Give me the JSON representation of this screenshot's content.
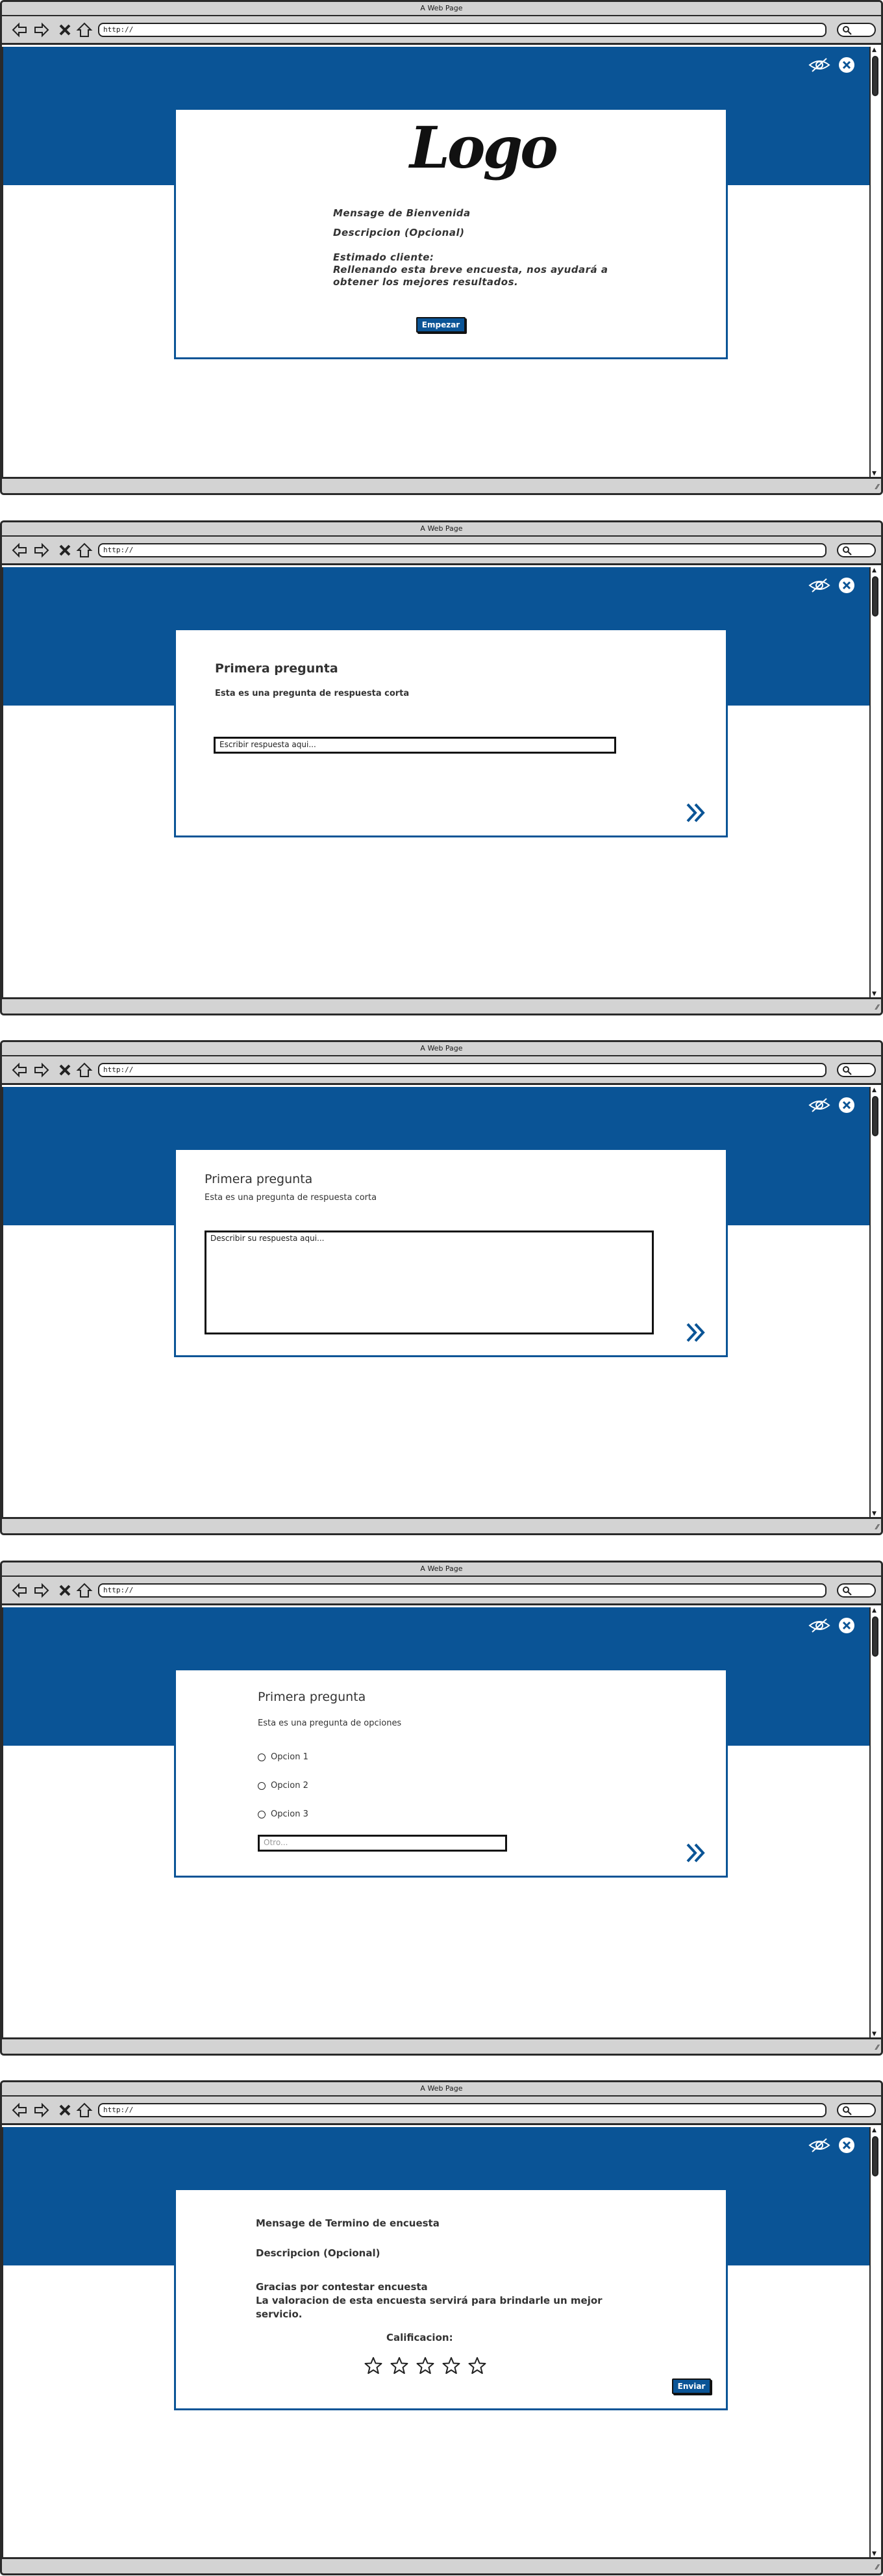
{
  "browser": {
    "window_title": "A Web Page",
    "url": "http://"
  },
  "colors": {
    "brand_blue": "#0a5496",
    "chrome_gray": "#d3d3d3"
  },
  "icons": [
    "back-arrow-icon",
    "forward-arrow-icon",
    "close-x-icon",
    "home-icon",
    "search-icon",
    "eye-slash-icon",
    "close-circle-icon",
    "double-chevron-right-icon",
    "star-icon",
    "resize-grip-icon"
  ],
  "screens": {
    "welcome": {
      "logo_text": "Logo",
      "welcome_message": "Mensage de Bienvenida",
      "description": "Descripcion (Opcional)",
      "greeting_line1": "Estimado cliente:",
      "greeting_line2": "Rellenando esta breve encuesta, nos ayudará a",
      "greeting_line3": "obtener los mejores resultados.",
      "start_button": "Empezar"
    },
    "short_answer": {
      "question_title": "Primera pregunta",
      "question_subtitle": "Esta es una pregunta de respuesta corta",
      "input_placeholder": "Escribir respuesta aqui..."
    },
    "long_answer": {
      "question_title": "Primera pregunta",
      "question_subtitle": "Esta es una pregunta de respuesta corta",
      "textarea_placeholder": "Describir su respuesta aqui..."
    },
    "options": {
      "question_title": "Primera pregunta",
      "question_subtitle": "Esta es una pregunta de opciones",
      "option1": "Opcion 1",
      "option2": "Opcion 2",
      "option3": "Opcion 3",
      "other_placeholder": "Otro..."
    },
    "finish": {
      "finish_message": "Mensage de Termino de encuesta",
      "description": "Descripcion (Opcional)",
      "thanks_line1": "Gracias por contestar encuesta",
      "thanks_line2": "La valoracion de esta encuesta servirá para brindarle un mejor",
      "thanks_line3": "servicio.",
      "rating_label": "Calificacion:",
      "rating_stars_total": 5,
      "rating_stars_filled": 0,
      "submit_button": "Enviar"
    }
  }
}
